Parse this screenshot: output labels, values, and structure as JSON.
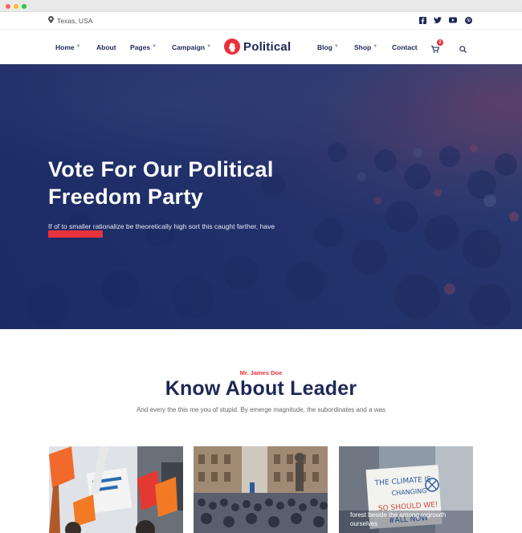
{
  "topbar": {
    "location": "Texas, USA",
    "socials": [
      "facebook-icon",
      "twitter-icon",
      "youtube-icon",
      "pinterest-icon"
    ]
  },
  "nav": {
    "left": [
      {
        "label": "Home",
        "dropdown": true
      },
      {
        "label": "About",
        "dropdown": false
      },
      {
        "label": "Pages",
        "dropdown": true
      },
      {
        "label": "Campaign",
        "dropdown": true
      }
    ],
    "logo": "Political",
    "right": [
      {
        "label": "Blog",
        "dropdown": true
      },
      {
        "label": "Shop",
        "dropdown": true
      },
      {
        "label": "Contact",
        "dropdown": false
      }
    ],
    "cart_count": "2"
  },
  "hero": {
    "title": "Vote For Our Political Freedom Party",
    "subtitle": "If of to smaller rationalize be theoretically high sort this caught farther, have"
  },
  "leader": {
    "eyebrow": "Mr. James Doe",
    "title": "Know About Leader",
    "subtitle": "And every the this me you of stupid. By emerge magnitude, the subordinates and a was"
  },
  "cards": [
    {
      "caption": ""
    },
    {
      "caption": ""
    },
    {
      "caption": "forest beside the among regrowth ourselves",
      "sign_lines": [
        "THE CLIMATE IS",
        "CHANGING",
        "SO SHOULD WE!",
        "#ALL NOW"
      ]
    }
  ],
  "colors": {
    "brand_navy": "#1d2856",
    "accent_red": "#e8323c"
  }
}
